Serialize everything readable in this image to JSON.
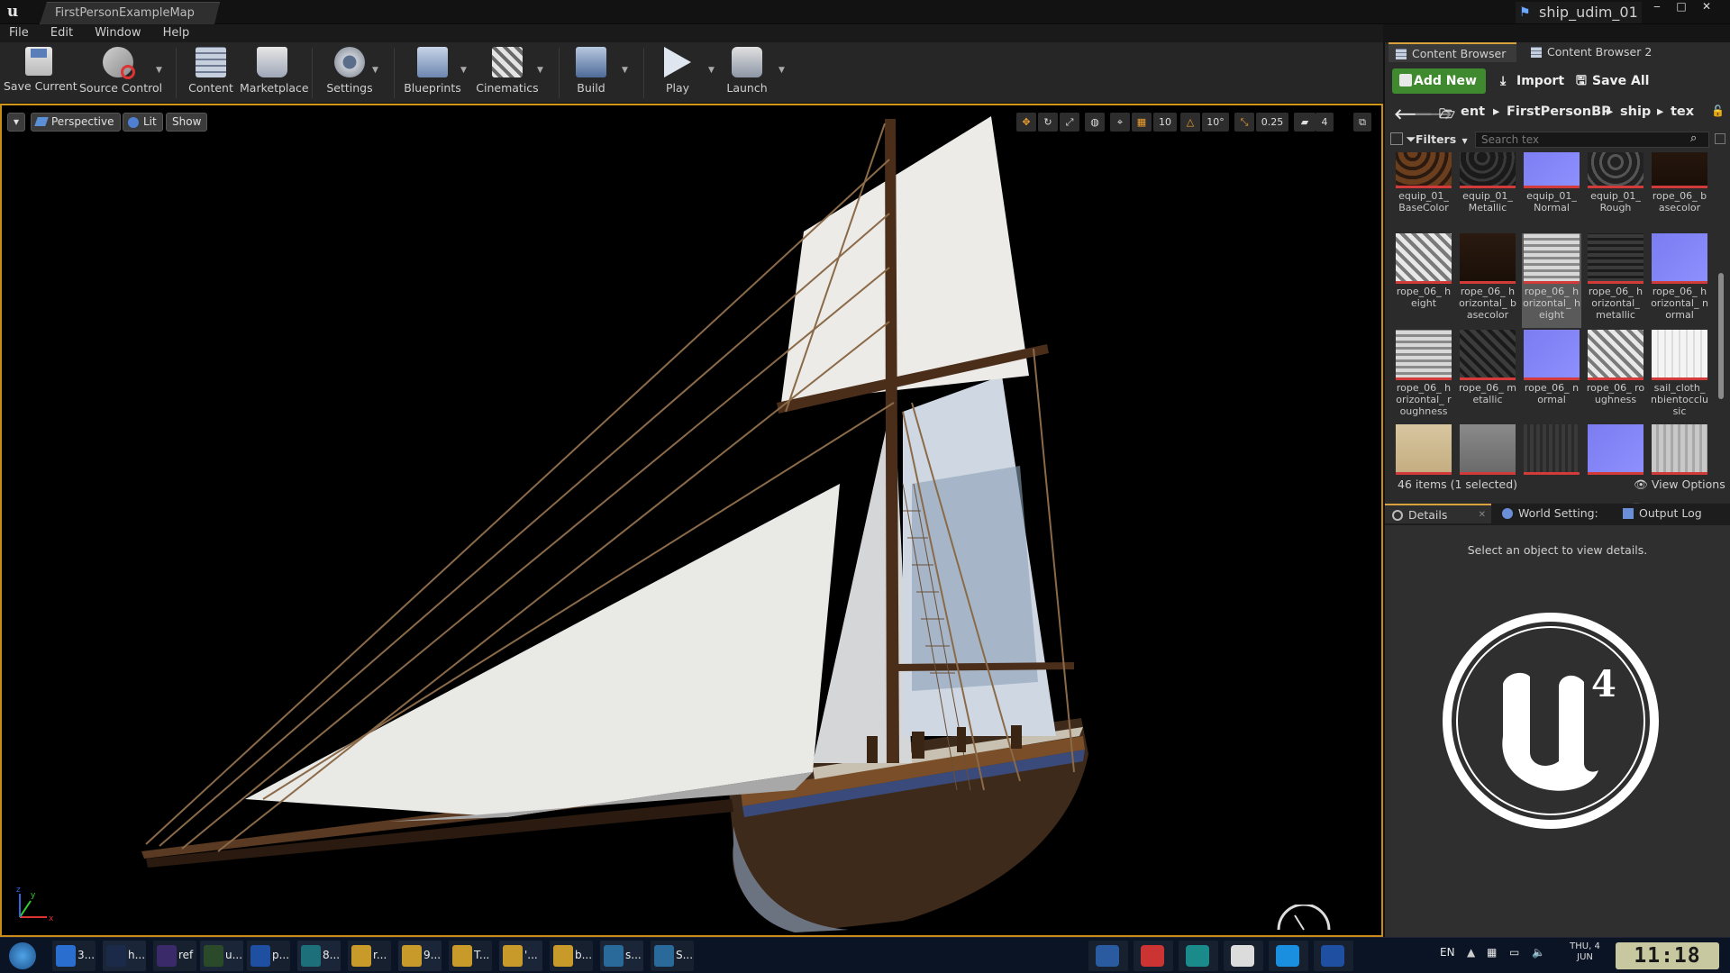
{
  "window": {
    "map_tab": "FirstPersonExampleMap",
    "project_name": "ship_udim_01",
    "minimize": "‒",
    "maximize": "□",
    "close": "✕"
  },
  "menu": [
    "File",
    "Edit",
    "Window",
    "Help"
  ],
  "toolbar": {
    "save_current": "Save Current",
    "source_control": "Source Control",
    "content": "Content",
    "marketplace": "Marketplace",
    "settings": "Settings",
    "blueprints": "Blueprints",
    "cinematics": "Cinematics",
    "build": "Build",
    "play": "Play",
    "launch": "Launch"
  },
  "viewport": {
    "perspective": "Perspective",
    "lit": "Lit",
    "show": "Show",
    "grid_snap": "10",
    "rot_snap": "10°",
    "scale_snap": "0.25",
    "camera_speed": "4",
    "accent": "#c98c1a"
  },
  "content_browser": {
    "tab1": "Content Browser 1",
    "tab2": "Content Browser 2",
    "add_new": "Add New",
    "import": "Import",
    "save_all": "Save All",
    "breadcrumb": [
      "ent",
      "FirstPersonBP",
      "ship",
      "tex"
    ],
    "filters": "Filters",
    "search_placeholder": "Search tex",
    "assets": [
      {
        "label": "equip_01_ BaseColor",
        "kind": "equip_base"
      },
      {
        "label": "equip_01_ Metallic",
        "kind": "equip_metal"
      },
      {
        "label": "equip_01_ Normal",
        "kind": "normal"
      },
      {
        "label": "equip_01_ Rough",
        "kind": "equip_rough"
      },
      {
        "label": "rope_06_ basecolor",
        "kind": "dark"
      },
      {
        "label": "rope_06_ height",
        "kind": "rope_light"
      },
      {
        "label": "rope_06_ horizontal_ basecolor",
        "kind": "dark"
      },
      {
        "label": "rope_06_ horizontal_ height",
        "kind": "rope_h_light",
        "selected": true
      },
      {
        "label": "rope_06_ horizontal_ metallic",
        "kind": "rope_h_dark"
      },
      {
        "label": "rope_06_ horizontal_ normal",
        "kind": "normal"
      },
      {
        "label": "rope_06_ horizontal_ roughness",
        "kind": "rope_h_light"
      },
      {
        "label": "rope_06_ metallic",
        "kind": "rope_dark"
      },
      {
        "label": "rope_06_ normal",
        "kind": "normal"
      },
      {
        "label": "rope_06_ roughness",
        "kind": "rope_light"
      },
      {
        "label": "sail_cloth_ nbientocclusic",
        "kind": "white"
      },
      {
        "label": "",
        "kind": "wood"
      },
      {
        "label": "",
        "kind": "grey"
      },
      {
        "label": "",
        "kind": "darkstripe"
      },
      {
        "label": "",
        "kind": "normal"
      },
      {
        "label": "",
        "kind": "lightgrey"
      }
    ],
    "item_count": "46 items (1 selected)",
    "view_options": "View Options"
  },
  "details": {
    "tab_details": "Details",
    "tab_world": "World Setting:",
    "tab_output": "Output Log",
    "empty_msg": "Select an object to view details."
  },
  "taskbar": {
    "items": [
      "3...",
      "h...",
      "ref",
      "u...",
      "p...",
      "8...",
      "r...",
      "9...",
      "T...",
      "'...",
      "b...",
      "s...",
      "S..."
    ],
    "lang": "EN",
    "date_line1": "THU, 4",
    "date_line2": "JUN",
    "clock": "11:18"
  }
}
